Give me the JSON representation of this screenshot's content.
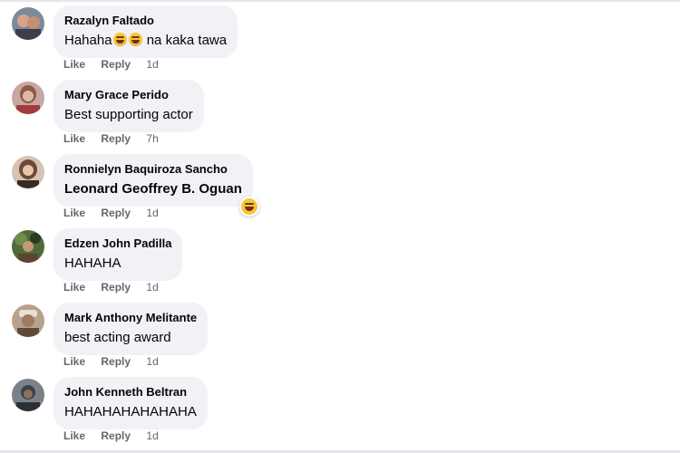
{
  "comments": [
    {
      "author": "Razalyn Faltado",
      "text_before": "Hahaha",
      "emoji_count": 2,
      "text_after": " na kaka tawa",
      "like": "Like",
      "reply": "Reply",
      "time": "1d",
      "avatar_colors": [
        "#7d8a9c",
        "#d9a48a"
      ]
    },
    {
      "author": "Mary Grace Perido",
      "text": "Best supporting actor",
      "like": "Like",
      "reply": "Reply",
      "time": "7h",
      "avatar_colors": [
        "#c9a7a1",
        "#8a5a4c"
      ]
    },
    {
      "author": "Ronnielyn Baquiroza Sancho",
      "text": "Leonard Geoffrey B. Oguan",
      "text_is_mention": true,
      "reaction_icon": "laughing-emoji-icon",
      "like": "Like",
      "reply": "Reply",
      "time": "1d",
      "avatar_colors": [
        "#d8c2b4",
        "#6b4a3a"
      ]
    },
    {
      "author": "Edzen John Padilla",
      "text": "HAHAHA",
      "like": "Like",
      "reply": "Reply",
      "time": "1d",
      "avatar_colors": [
        "#4f6b3a",
        "#2d3a22"
      ]
    },
    {
      "author": "Mark Anthony Melitante",
      "text": "best acting award",
      "like": "Like",
      "reply": "Reply",
      "time": "1d",
      "avatar_colors": [
        "#b7a38c",
        "#5e4a38"
      ]
    },
    {
      "author": "John Kenneth Beltran",
      "text": "HAHAHAHAHAHAHA",
      "like": "Like",
      "reply": "Reply",
      "time": "1d",
      "avatar_colors": [
        "#3b4146",
        "#7a8189"
      ]
    }
  ],
  "colors": {
    "bubble": "#f0f2f5",
    "meta_text": "#65676b",
    "emoji": "#f7c537"
  }
}
